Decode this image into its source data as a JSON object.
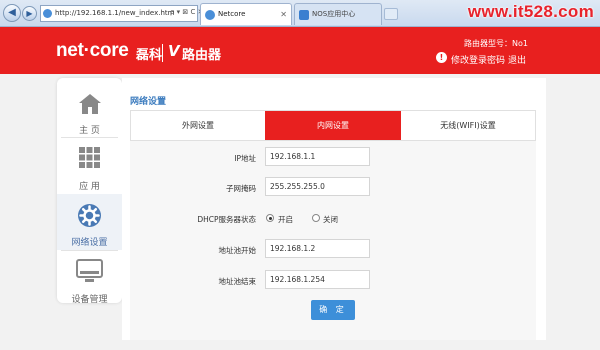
{
  "browser": {
    "address": "http://192.168.1.1/new_index.htm",
    "address_tools": "ρ ▾ ⊠ C ✕",
    "tabs": [
      {
        "label": "Netcore",
        "active": true
      },
      {
        "label": "NOS应用中心",
        "active": false
      }
    ],
    "watermark": "www.it528.com"
  },
  "header": {
    "logo_text": "net·core",
    "logo_cn": "磊科",
    "logo_product": "路由器",
    "model_label": "路由器型号：No1",
    "change_password": "修改登录密码",
    "logout": "退出",
    "brand_color": "#e8201f"
  },
  "sidebar": {
    "items": [
      {
        "label": "主 页",
        "icon": "home-icon",
        "active": false
      },
      {
        "label": "应 用",
        "icon": "apps-grid-icon",
        "active": false
      },
      {
        "label": "网络设置",
        "icon": "network-settings-gear-icon",
        "active": true
      },
      {
        "label": "设备管理",
        "icon": "device-monitor-icon",
        "active": false
      }
    ]
  },
  "main": {
    "title": "网络设置",
    "tabs": [
      {
        "label": "外网设置",
        "active": false
      },
      {
        "label": "内网设置",
        "active": true
      },
      {
        "label": "无线(WIFI)设置",
        "active": false
      }
    ],
    "form": {
      "ip_label": "IP地址",
      "ip_value": "192.168.1.1",
      "mask_label": "子网掩码",
      "mask_value": "255.255.255.0",
      "dhcp_label": "DHCP服务器状态",
      "dhcp_on": "开启",
      "dhcp_off": "关闭",
      "dhcp_selected": "开启",
      "pool_start_label": "地址池开始",
      "pool_start_value": "192.168.1.2",
      "pool_end_label": "地址池结束",
      "pool_end_value": "192.168.1.254",
      "confirm_label": "确 定"
    }
  }
}
